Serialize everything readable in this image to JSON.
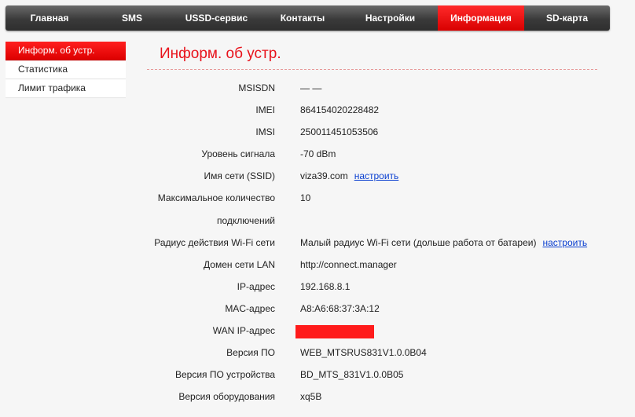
{
  "nav": {
    "tabs": [
      {
        "label": "Главная"
      },
      {
        "label": "SMS"
      },
      {
        "label": "USSD-сервис"
      },
      {
        "label": "Контакты"
      },
      {
        "label": "Настройки"
      },
      {
        "label": "Информация"
      },
      {
        "label": "SD-карта"
      }
    ],
    "active_index": 5
  },
  "sidebar": {
    "items": [
      {
        "label": "Информ. об устр."
      },
      {
        "label": "Статистика"
      },
      {
        "label": "Лимит трафика"
      }
    ],
    "active_index": 0
  },
  "main": {
    "title": "Информ. об устр.",
    "rows": [
      {
        "label": "MSISDN",
        "value": "— —"
      },
      {
        "label": "IMEI",
        "value": "864154020228482"
      },
      {
        "label": "IMSI",
        "value": "250011451053506"
      },
      {
        "label": "Уровень сигнала",
        "value": "-70 dBm"
      },
      {
        "label": "Имя сети (SSID)",
        "value": "viza39.com",
        "link": "настроить"
      },
      {
        "label": "Максимальное количество",
        "value": "10"
      },
      {
        "label": "подключений",
        "value": ""
      },
      {
        "label": "Радиус действия Wi-Fi сети",
        "value": "Малый радиус Wi-Fi сети (дольше работа от батареи)",
        "link": "настроить"
      },
      {
        "label": "Домен сети LAN",
        "value": "http://connect.manager"
      },
      {
        "label": "IP-адрес",
        "value": "192.168.8.1"
      },
      {
        "label": "MAC-адрес",
        "value": "A8:A6:68:37:3A:12"
      },
      {
        "label": "WAN IP-адрес",
        "value": ""
      },
      {
        "label": "Версия ПО",
        "value": "WEB_MTSRUS831V1.0.0B04"
      },
      {
        "label": "Версия ПО устройства",
        "value": "BD_MTS_831V1.0.0B05"
      },
      {
        "label": "Версия оборудования",
        "value": "xq5B"
      }
    ]
  },
  "colors": {
    "accent": "#e8121b",
    "nav_bg": "#3a3a3a",
    "link": "#0a3fd0"
  }
}
